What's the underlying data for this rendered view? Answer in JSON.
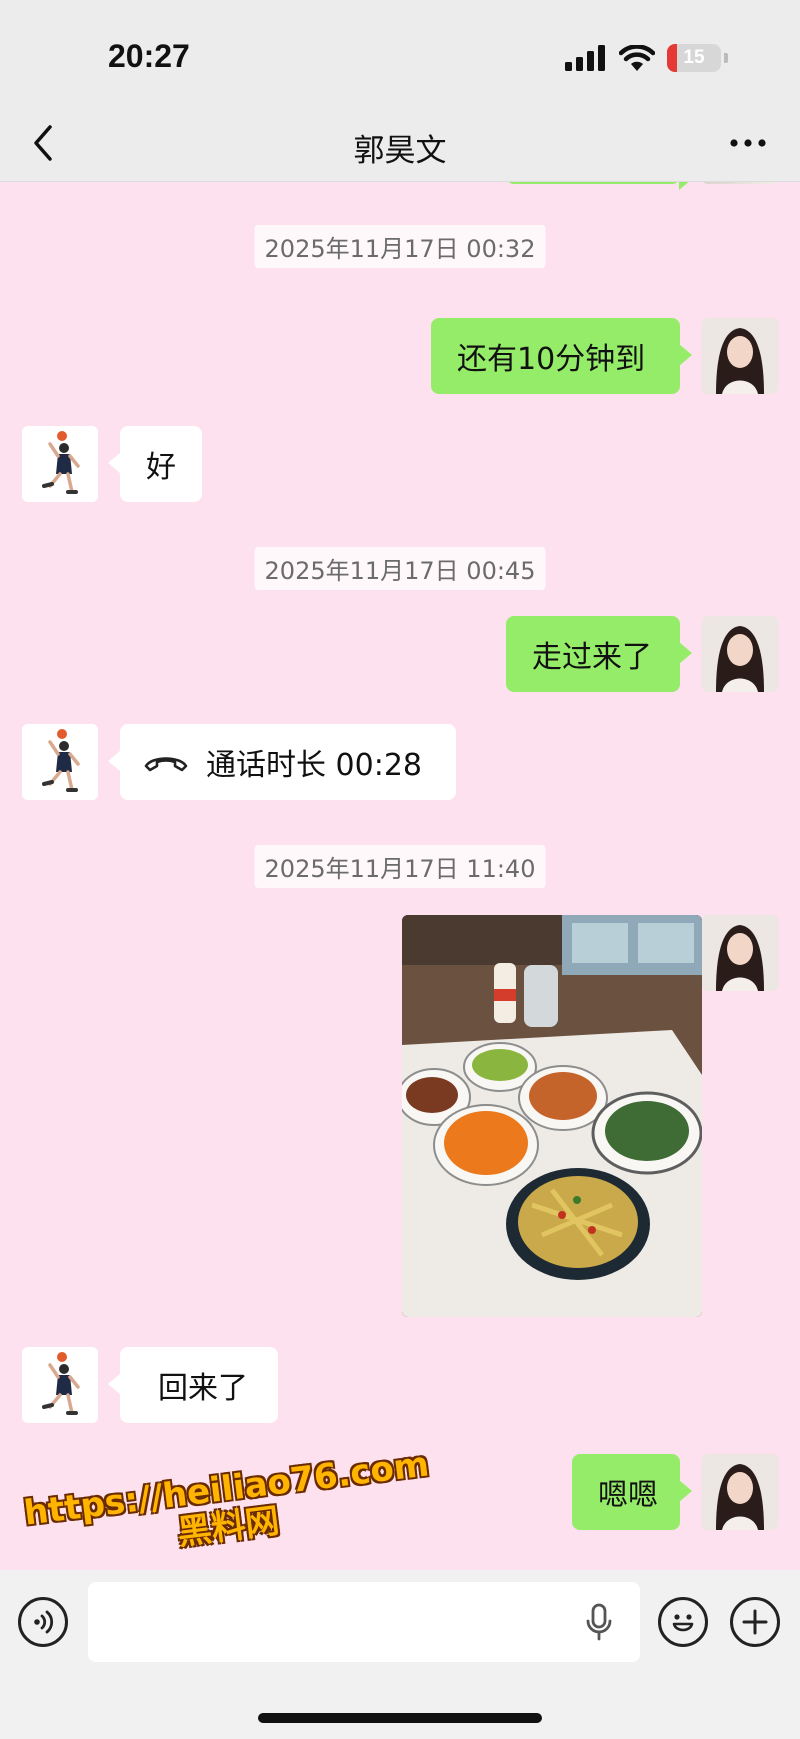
{
  "status_bar": {
    "time": "20:27",
    "battery_level": "15",
    "icons": [
      "signal-icon",
      "wifi-icon",
      "battery-icon"
    ]
  },
  "nav": {
    "title": "郭昊文",
    "icons": [
      "back-chevron-icon",
      "more-dots-icon"
    ]
  },
  "messages": [
    {
      "type": "timestamp",
      "text": "2025年11月17日 00:32"
    },
    {
      "type": "text",
      "from": "self",
      "text": "还有10分钟到"
    },
    {
      "type": "text",
      "from": "other",
      "text": "好"
    },
    {
      "type": "timestamp",
      "text": "2025年11月17日 00:45"
    },
    {
      "type": "text",
      "from": "self",
      "text": "走过来了"
    },
    {
      "type": "call",
      "from": "other",
      "text": "通话时长 00:28",
      "icon": "phone-hangup-icon"
    },
    {
      "type": "timestamp",
      "text": "2025年11月17日 11:40"
    },
    {
      "type": "image",
      "from": "self",
      "description_icon": "food-photo"
    },
    {
      "type": "text",
      "from": "other",
      "text": "回来了"
    },
    {
      "type": "text",
      "from": "self",
      "text": "嗯嗯"
    }
  ],
  "input_bar": {
    "icons": [
      "voice-icon",
      "microphone-icon",
      "emoji-icon",
      "plus-icon"
    ]
  },
  "watermark": {
    "line1": "https://heiliao76.com",
    "line2": "黑料网"
  },
  "colors": {
    "chat_background": "#fde1ee",
    "self_bubble": "#95ec69",
    "other_bubble": "#ffffff",
    "bar_background": "#ececec",
    "watermark": "#ffb400"
  }
}
